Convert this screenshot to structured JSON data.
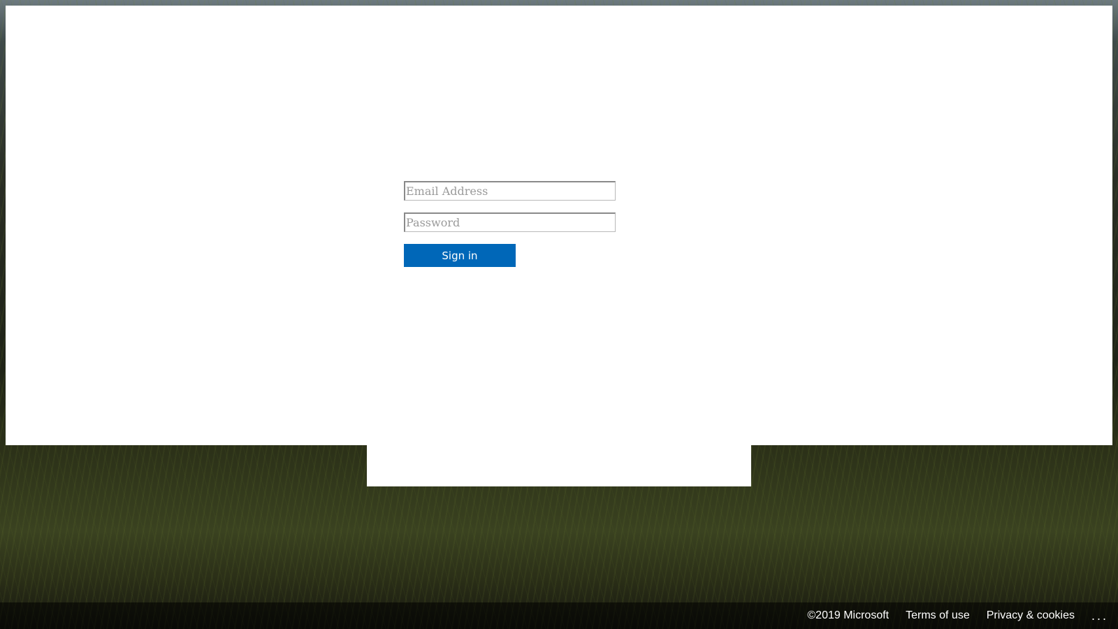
{
  "signin": {
    "email_placeholder": "Email Address",
    "password_placeholder": "Password",
    "button_label": "Sign in"
  },
  "footer": {
    "copyright": "©2019 Microsoft",
    "terms": "Terms of use",
    "privacy": "Privacy & cookies",
    "more": "..."
  },
  "colors": {
    "accent": "#0067b8",
    "panel": "#ffffff"
  }
}
